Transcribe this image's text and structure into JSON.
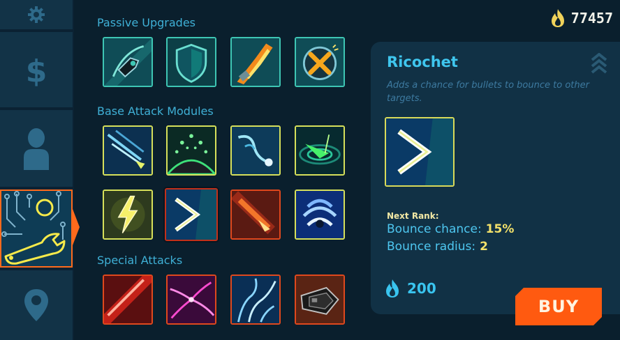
{
  "currency": {
    "amount": "77457",
    "icon": "flame-icon",
    "color": "#f0d25a"
  },
  "sidebar": {
    "tabs": [
      {
        "id": "settings",
        "icon": "gear-icon"
      },
      {
        "id": "shop",
        "icon": "dollar-icon"
      },
      {
        "id": "character",
        "icon": "person-icon"
      },
      {
        "id": "upgrades",
        "icon": "circuit-wrench-icon",
        "active": true
      },
      {
        "id": "map",
        "icon": "location-pin-icon"
      }
    ]
  },
  "sections": [
    {
      "title": "Passive Upgrades",
      "tiles": [
        {
          "icon": "ship-dash-icon",
          "border": "teal"
        },
        {
          "icon": "shield-icon",
          "border": "teal"
        },
        {
          "icon": "thruster-flame-icon",
          "border": "teal"
        },
        {
          "icon": "crossed-bomb-icon",
          "border": "teal"
        }
      ]
    },
    {
      "title": "Base Attack Modules",
      "tiles": [
        {
          "icon": "multi-shot-icon",
          "border": "yellow"
        },
        {
          "icon": "spread-orb-icon",
          "border": "yellow"
        },
        {
          "icon": "homing-shot-icon",
          "border": "yellow"
        },
        {
          "icon": "vortex-icon",
          "border": "yellow"
        },
        {
          "icon": "lightning-icon",
          "border": "yellow"
        },
        {
          "icon": "ricochet-icon",
          "border": "selected"
        },
        {
          "icon": "fire-bolt-icon",
          "border": "red"
        },
        {
          "icon": "sonic-wave-icon",
          "border": "yellow"
        }
      ]
    },
    {
      "title": "Special Attacks",
      "tiles": [
        {
          "icon": "laser-beam-icon",
          "border": "red"
        },
        {
          "icon": "plasma-tendrils-icon",
          "border": "red"
        },
        {
          "icon": "chain-lightning-icon",
          "border": "red"
        },
        {
          "icon": "rocket-launcher-icon",
          "border": "red"
        }
      ]
    }
  ],
  "detail": {
    "title": "Ricochet",
    "description": "Adds a chance for bullets to bounce to other targets.",
    "next_rank_label": "Next Rank:",
    "stats": [
      {
        "label": "Bounce chance:",
        "value": "15%"
      },
      {
        "label": "Bounce radius:",
        "value": "2"
      }
    ],
    "cost": "200",
    "buy_label": "BUY"
  }
}
